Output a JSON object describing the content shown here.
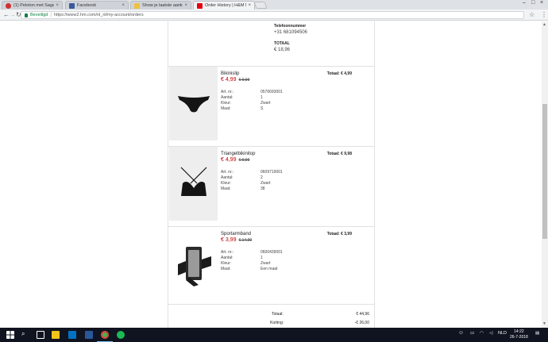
{
  "browser": {
    "tabs": [
      {
        "title": "(1) Peloton met Sagan b...",
        "icon_color": "#d32f2f"
      },
      {
        "title": "Facebook",
        "icon_color": "#3b5998"
      },
      {
        "title": "Show je laatste aankope...",
        "icon_color": "#f0c040"
      },
      {
        "title": "Order History | H&M Ne...",
        "icon_color": "#e50010"
      }
    ],
    "secure_label": "Beveiligd",
    "url": "https://www2.hm.com/nl_nl/my-account/orders"
  },
  "summary": {
    "phone_label": "Telefoonnummer",
    "phone_value": "+31 681094506",
    "total_label": "TOTAAL",
    "total_value": "€ 18,96"
  },
  "items": [
    {
      "name": "Bikinislip",
      "price": "€ 4,99",
      "old_price": "€ 9,99",
      "total": "Totaal: € 4,99",
      "details": [
        {
          "label": "Art. nr.:",
          "value": "0576693001"
        },
        {
          "label": "Aantal:",
          "value": "1"
        },
        {
          "label": "Kleur:",
          "value": "Zwart"
        },
        {
          "label": "Maat:",
          "value": "S"
        }
      ]
    },
    {
      "name": "Triangelbikinitop",
      "price": "€ 4,99",
      "old_price": "€ 9,99",
      "total": "Totaal: € 9,98",
      "details": [
        {
          "label": "Art. nr.:",
          "value": "0609719001"
        },
        {
          "label": "Aantal:",
          "value": "2"
        },
        {
          "label": "Kleur:",
          "value": "Zwart"
        },
        {
          "label": "Maat:",
          "value": "38"
        }
      ]
    },
    {
      "name": "Sportarmband",
      "price": "€ 3,99",
      "old_price": "€ 14,99",
      "total": "Totaal: € 3,99",
      "details": [
        {
          "label": "Art. nr.:",
          "value": "0600439001"
        },
        {
          "label": "Aantal:",
          "value": "1"
        },
        {
          "label": "Kleur:",
          "value": "Zwart"
        },
        {
          "label": "Maat:",
          "value": "Een maat"
        }
      ]
    }
  ],
  "totals": {
    "subtotal_label": "Totaal:",
    "subtotal_value": "€ 44,96",
    "discount_label": "Korting:",
    "discount_value": "-€ 26,00"
  },
  "taskbar": {
    "time": "14:22",
    "date": "26-7-2018",
    "language": "NLD"
  },
  "colors": {
    "sale_price": "#c40000",
    "secure": "#0b8043"
  }
}
